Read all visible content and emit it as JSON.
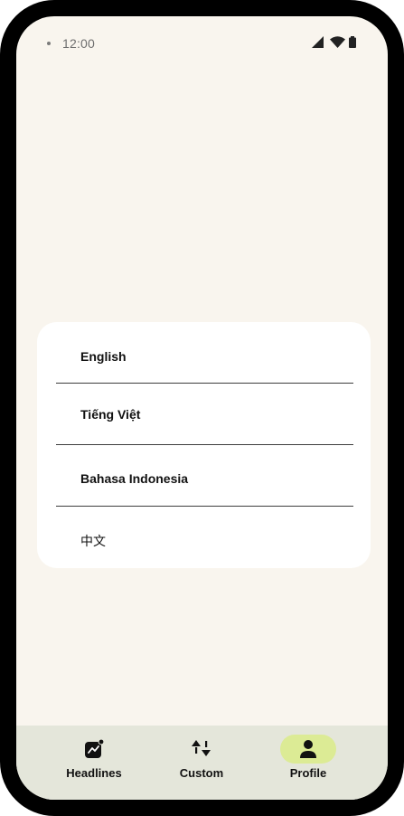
{
  "status_bar": {
    "time": "12:00",
    "icons": [
      "signal-icon",
      "wifi-icon",
      "battery-icon"
    ]
  },
  "language_dialog": {
    "options": [
      {
        "label": "English"
      },
      {
        "label": "Tiếng Việt"
      },
      {
        "label": "Bahasa Indonesia"
      },
      {
        "label": "中文"
      }
    ]
  },
  "bottom_nav": {
    "items": [
      {
        "label": "Headlines",
        "icon": "headlines-icon",
        "active": false
      },
      {
        "label": "Custom",
        "icon": "custom-icon",
        "active": false
      },
      {
        "label": "Profile",
        "icon": "profile-icon",
        "active": true
      }
    ],
    "active_color": "#dceb95"
  },
  "colors": {
    "background": "#f9f5ee",
    "nav_background": "#e4e6da",
    "frame": "#000000"
  }
}
